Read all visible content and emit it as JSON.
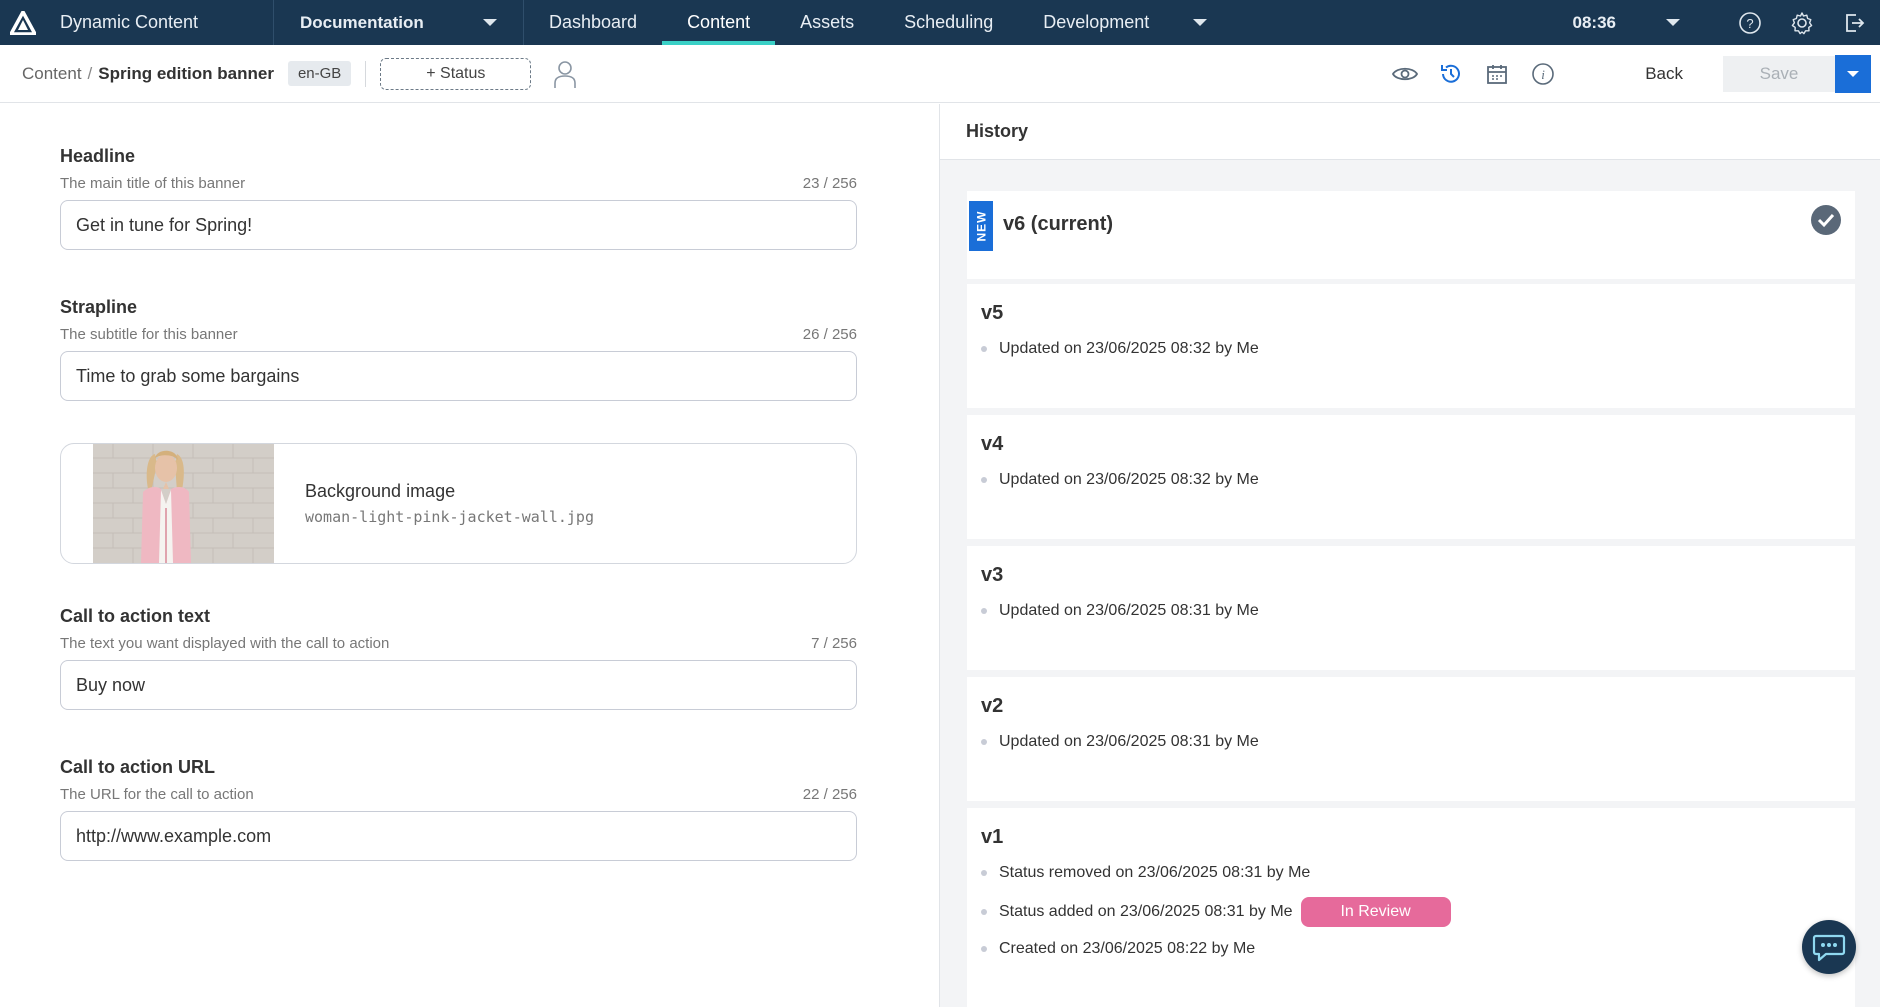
{
  "topnav": {
    "app_name": "Dynamic Content",
    "hub": "Documentation",
    "tabs": [
      "Dashboard",
      "Content",
      "Assets",
      "Scheduling",
      "Development"
    ],
    "active_tab": "Content",
    "time": "08:36",
    "accent_color": "#3ad0c6",
    "bg_color": "#1a3752"
  },
  "toolbar": {
    "breadcrumb_root": "Content",
    "breadcrumb_sep": "/",
    "breadcrumb_current": "Spring edition banner",
    "locale": "en-GB",
    "status_label": "+ Status",
    "back_label": "Back",
    "save_label": "Save"
  },
  "form": {
    "headline": {
      "label": "Headline",
      "help": "The main title of this banner",
      "count": "23 / 256",
      "value": "Get in tune for Spring!"
    },
    "strapline": {
      "label": "Strapline",
      "help": "The subtitle for this banner",
      "count": "26 / 256",
      "value": "Time to grab some bargains"
    },
    "image": {
      "title": "Background image",
      "filename": "woman-light-pink-jacket-wall.jpg"
    },
    "cta_text": {
      "label": "Call to action text",
      "help": "The text you want displayed with the call to action",
      "count": "7 / 256",
      "value": "Buy now"
    },
    "cta_url": {
      "label": "Call to action URL",
      "help": "The URL for the call to action",
      "count": "22 / 256",
      "value": "http://www.example.com"
    }
  },
  "history": {
    "title": "History",
    "new_badge": "NEW",
    "versions": [
      {
        "name": "v6 (current)",
        "events": []
      },
      {
        "name": "v5",
        "events": [
          "Updated on 23/06/2025 08:32 by Me"
        ]
      },
      {
        "name": "v4",
        "events": [
          "Updated on 23/06/2025 08:32 by Me"
        ]
      },
      {
        "name": "v3",
        "events": [
          "Updated on 23/06/2025 08:31 by Me"
        ]
      },
      {
        "name": "v2",
        "events": [
          "Updated on 23/06/2025 08:31 by Me"
        ]
      },
      {
        "name": "v1",
        "events": [
          "Status removed on 23/06/2025 08:31 by Me",
          "Status added on 23/06/2025 08:31 by Me",
          "Created on 23/06/2025 08:22 by Me"
        ]
      }
    ],
    "review_badge": "In Review",
    "review_color": "#e66a9b"
  }
}
